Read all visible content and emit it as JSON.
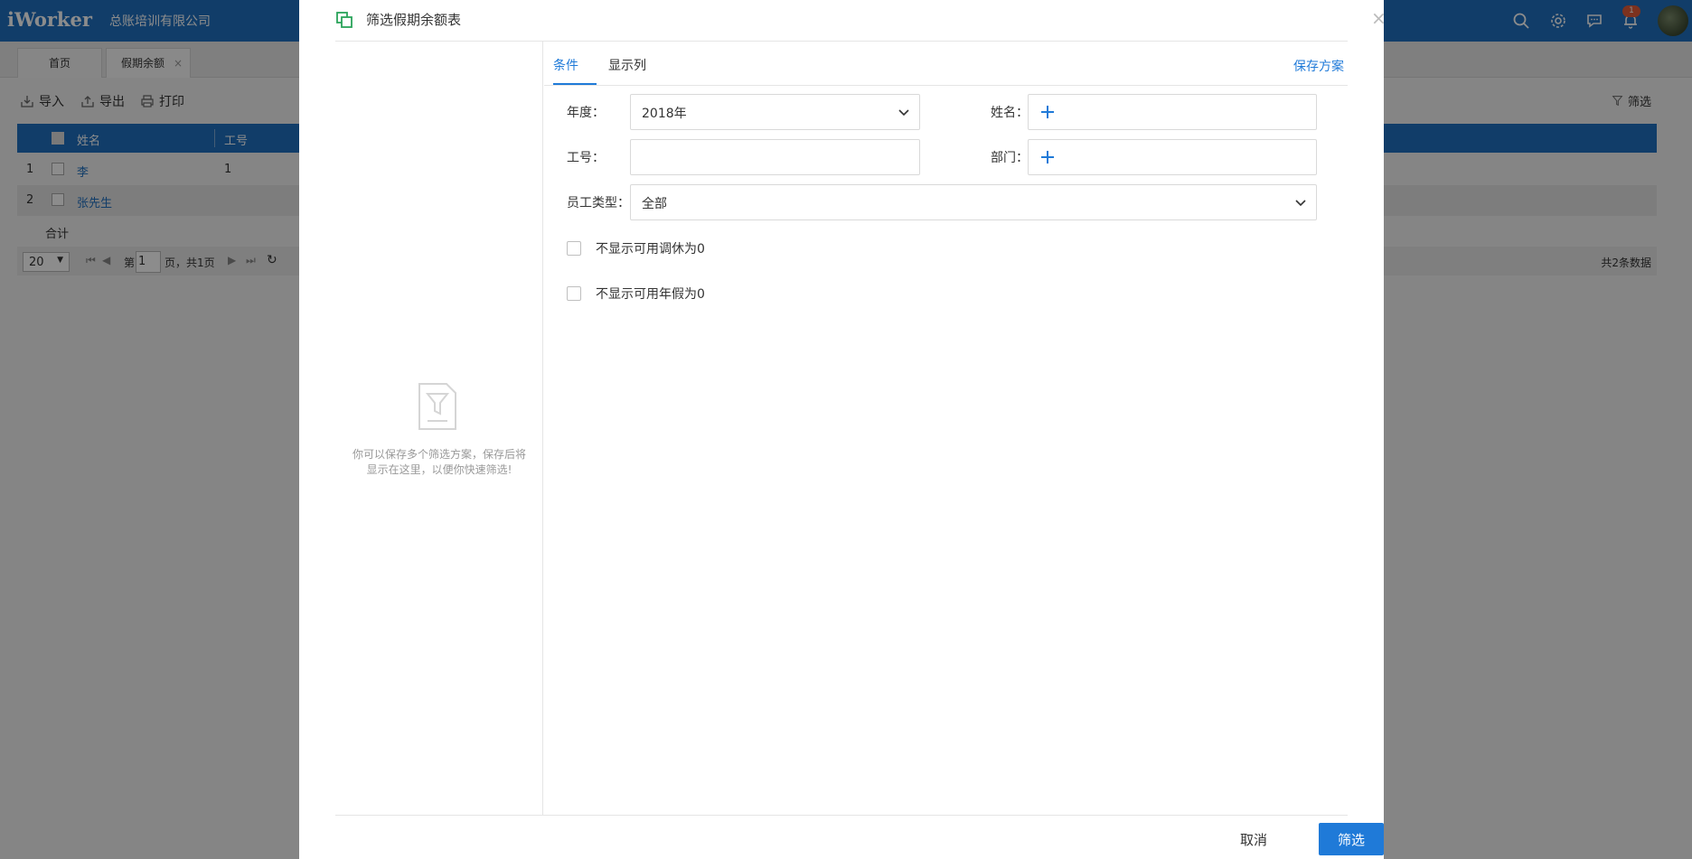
{
  "app": {
    "logo": "iWorker",
    "company": "总账培训有限公司",
    "notification_count": "1"
  },
  "tabs": [
    {
      "label": "首页"
    },
    {
      "label": "假期余额"
    }
  ],
  "toolbar": {
    "import_label": "导入",
    "export_label": "导出",
    "print_label": "打印",
    "filter_label": "筛选"
  },
  "grid": {
    "columns": [
      "姓名",
      "工号"
    ],
    "rows": [
      {
        "index": "1",
        "name": "李",
        "id": "1"
      },
      {
        "index": "2",
        "name": "张先生",
        "id": ""
      }
    ],
    "total_label": "合计"
  },
  "pager": {
    "page_size": "20",
    "page_prefix": "第",
    "page_number": "1",
    "page_suffix": "页，共1页",
    "summary": "共2条数据"
  },
  "modal": {
    "title": "筛选假期余额表",
    "close": "×",
    "empty_hint": "你可以保存多个筛选方案，保存后将显示在这里，以便你快速筛选!",
    "tabs": [
      {
        "label": "条件"
      },
      {
        "label": "显示列"
      }
    ],
    "save_plan": "保存方案",
    "fields": {
      "year_label": "年度：",
      "year_value": "2018年",
      "name_label": "姓名：",
      "id_label": "工号：",
      "id_value": "",
      "dept_label": "部门：",
      "type_label": "员工类型：",
      "type_value": "全部"
    },
    "checkboxes": [
      "不显示可用调休为0",
      "不显示可用年假为0"
    ],
    "cancel_label": "取消",
    "submit_label": "筛选"
  },
  "colors": {
    "brand": "#1f6fbf",
    "accent": "#1f7ad8",
    "title_icon": "#2aa35a"
  }
}
